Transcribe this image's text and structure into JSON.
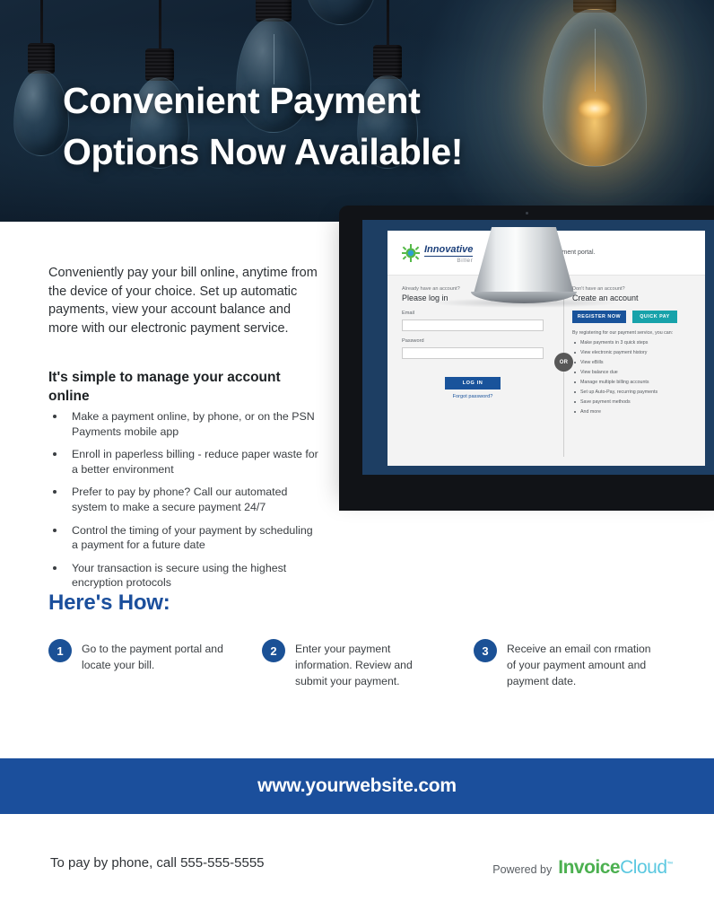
{
  "hero": {
    "title_line1": "Convenient Payment",
    "title_line2": "Options Now Available!"
  },
  "intro": {
    "paragraph": "Conveniently pay your bill online, anytime from the device of your choice. Set up automatic payments, view your account balance and more with our electronic payment service.",
    "subhead": "It's simple to manage your account online"
  },
  "bullets": [
    "Make a payment online, by phone, or on the PSN Payments mobile app",
    "Enroll in paperless billing - reduce paper waste for a better environment",
    "Prefer to pay by phone? Call our automated system to make a secure payment 24/7",
    "Control the timing of your payment by scheduling a payment for a future date",
    "Your transaction is secure using the highest encryption protocols"
  ],
  "here_how": {
    "title": "Here's How:",
    "steps": [
      {
        "number": "1",
        "text": "Go to the payment portal and locate your bill."
      },
      {
        "number": "2",
        "text": "Enter your payment information. Review and submit your payment."
      },
      {
        "number": "3",
        "text": "Receive an email con rmation of your payment amount and payment date."
      }
    ]
  },
  "portal": {
    "logo_name": "Innovative",
    "logo_sub": "Biller",
    "welcome": "Welcome to our secure payment portal.",
    "login": {
      "eyebrow": "Already have an account?",
      "title": "Please log in",
      "email_label": "Email",
      "email_value": "",
      "password_label": "Password",
      "password_value": "",
      "button": "LOG IN",
      "forgot": "Forgot password?"
    },
    "or_label": "OR",
    "create": {
      "eyebrow": "Don't have an account?",
      "title": "Create an account",
      "register_button": "REGISTER NOW",
      "quickpay_button": "QUICK PAY",
      "benefits_intro": "By registering for our payment service, you can:",
      "benefits": [
        "Make payments in 3 quick steps",
        "View electronic payment history",
        "View eBills",
        "View balance due",
        "Manage multiple billing accounts",
        "Set up Auto-Pay, recurring payments",
        "Save payment methods",
        "And more"
      ]
    }
  },
  "footer": {
    "website": "www.yourwebsite.com",
    "phone_line": "To pay by phone, call 555-555-5555",
    "powered_by": "Powered by",
    "brand_first": "Invoice",
    "brand_second": "Cloud",
    "brand_tm": "™"
  },
  "colors": {
    "navy": "#1b4f9c",
    "teal": "#17a2aa",
    "hero_bg": "#0d1b2a",
    "brand_green": "#4cb050",
    "brand_blue": "#5bc8e0"
  }
}
